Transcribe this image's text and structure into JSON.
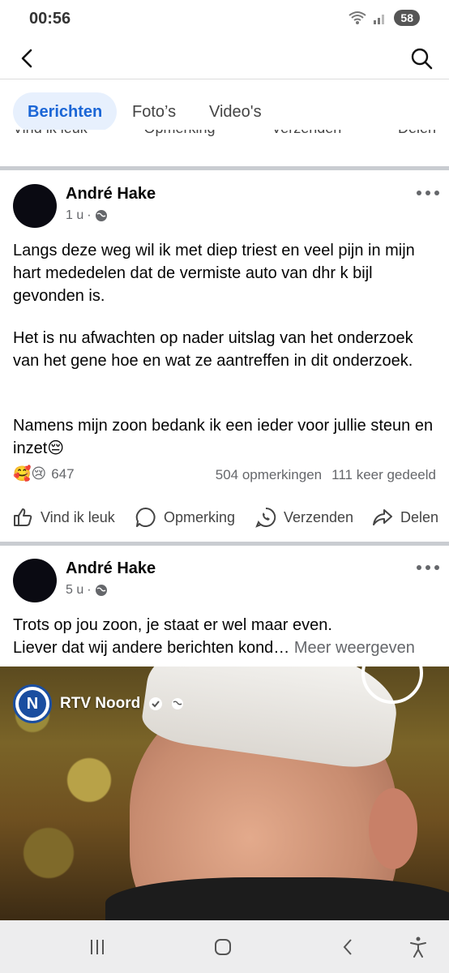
{
  "status_bar": {
    "time": "00:56",
    "battery": "58"
  },
  "tabs": [
    {
      "label": "Berichten",
      "active": true
    },
    {
      "label": "Foto’s",
      "active": false
    },
    {
      "label": "Video's",
      "active": false
    }
  ],
  "actions": {
    "like": "Vind ik leuk",
    "comment": "Opmerking",
    "send": "Verzenden",
    "share": "Delen"
  },
  "post1": {
    "author": "André Hake",
    "time": "1 u",
    "paragraphs": [
      "Langs deze weg wil ik met diep triest en veel pijn in mijn hart mededelen dat de vermiste auto van dhr k bijl gevonden is.",
      "Het is nu afwachten op nader uitslag van het onderzoek van het gene hoe en wat ze aantreffen in dit onderzoek.",
      "Namens mijn zoon bedank ik een ieder voor jullie steun en inzet😔"
    ],
    "reactions": "🥰😢",
    "reaction_count": "647",
    "comments": "504 opmerkingen",
    "shares": "111 keer gedeeld"
  },
  "post2": {
    "author": "André Hake",
    "time": "5 u",
    "text_line1": "Trots op jou zoon, je staat er wel maar even.",
    "text_line2": "Liever dat wij andere berichten kond…",
    "see_more": "Meer weergeven",
    "shared_source": "RTV Noord",
    "shared_logo_letter": "N"
  },
  "colors": {
    "accent": "#1b66d6",
    "tab_active_bg": "#e7f0fd",
    "secondary_text": "#65676b",
    "divider": "#c9ccd1"
  }
}
